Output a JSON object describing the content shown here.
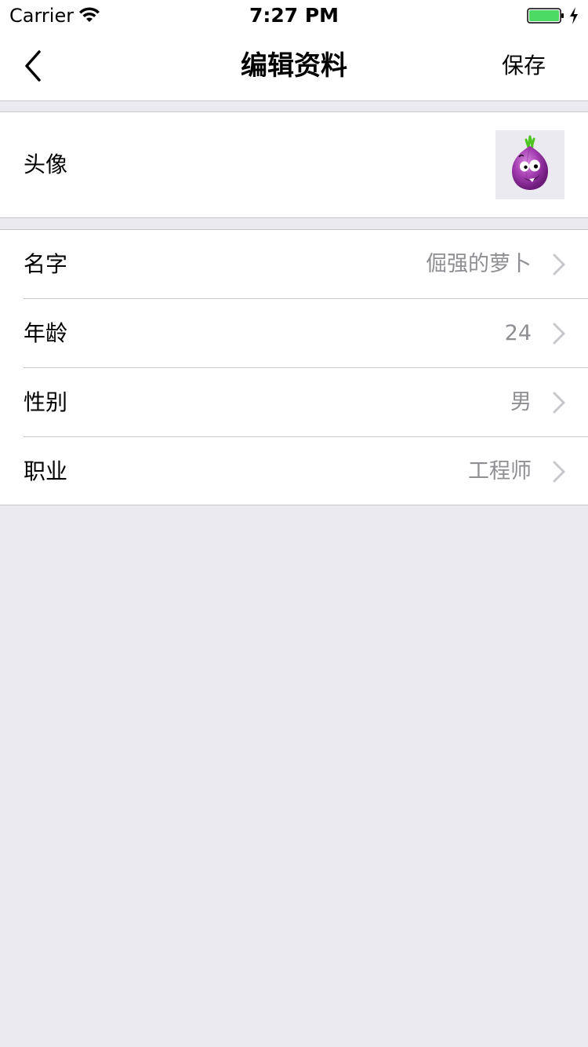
{
  "status_bar": {
    "carrier": "Carrier",
    "time": "7:27 PM",
    "battery_color": "#4cd964"
  },
  "nav": {
    "back_icon": "chevron-left-icon",
    "title": "编辑资料",
    "save_label": "保存"
  },
  "avatar_section": {
    "label": "头像",
    "image": "purple-onion-cartoon"
  },
  "info_section": {
    "rows": [
      {
        "label": "名字",
        "value": "倔强的萝卜"
      },
      {
        "label": "年龄",
        "value": "24"
      },
      {
        "label": "性别",
        "value": "男"
      },
      {
        "label": "职业",
        "value": "工程师"
      }
    ]
  },
  "colors": {
    "background": "#ebeaf0",
    "separator": "#c8c7cc",
    "secondary_text": "#8e8e93"
  }
}
